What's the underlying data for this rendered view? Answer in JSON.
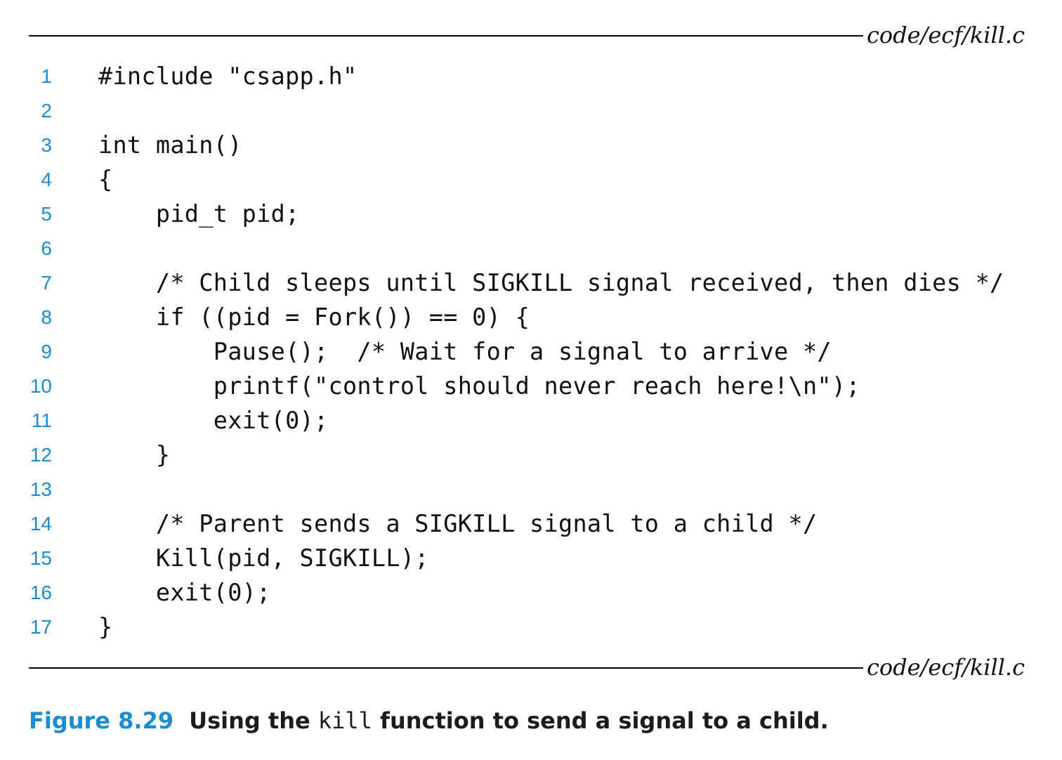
{
  "file_label": "code/ecf/kill.c",
  "code_lines": [
    {
      "num": "1",
      "text": "#include \"csapp.h\""
    },
    {
      "num": "2",
      "text": ""
    },
    {
      "num": "3",
      "text": "int main()"
    },
    {
      "num": "4",
      "text": "{"
    },
    {
      "num": "5",
      "text": "    pid_t pid;"
    },
    {
      "num": "6",
      "text": ""
    },
    {
      "num": "7",
      "text": "    /* Child sleeps until SIGKILL signal received, then dies */"
    },
    {
      "num": "8",
      "text": "    if ((pid = Fork()) == 0) {"
    },
    {
      "num": "9",
      "text": "        Pause();  /* Wait for a signal to arrive */"
    },
    {
      "num": "10",
      "text": "        printf(\"control should never reach here!\\n\");"
    },
    {
      "num": "11",
      "text": "        exit(0);"
    },
    {
      "num": "12",
      "text": "    }"
    },
    {
      "num": "13",
      "text": ""
    },
    {
      "num": "14",
      "text": "    /* Parent sends a SIGKILL signal to a child */"
    },
    {
      "num": "15",
      "text": "    Kill(pid, SIGKILL);"
    },
    {
      "num": "16",
      "text": "    exit(0);"
    },
    {
      "num": "17",
      "text": "}"
    }
  ],
  "caption": {
    "label": "Figure 8.29",
    "text_before": "Using the ",
    "code_word": "kill",
    "text_after": " function to send a signal to a child."
  },
  "colors": {
    "accent": "#1a8ccf",
    "text": "#111111"
  }
}
